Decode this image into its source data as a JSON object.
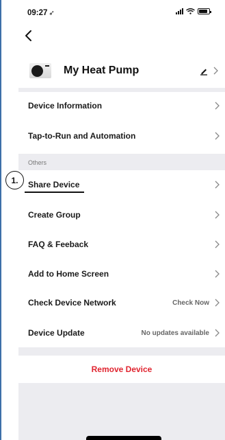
{
  "status_bar": {
    "time": "09:27",
    "location_arrow": "location-arrow-icon"
  },
  "device": {
    "name": "My Heat Pump"
  },
  "menu_top": [
    {
      "label": "Device Information"
    },
    {
      "label": "Tap-to-Run and Automation"
    }
  ],
  "section_others": "Others",
  "menu_others": [
    {
      "label": "Share Device"
    },
    {
      "label": "Create Group"
    },
    {
      "label": "FAQ & Feeback"
    },
    {
      "label": "Add to Home Screen"
    },
    {
      "label": "Check Device Network",
      "value": "Check Now"
    },
    {
      "label": "Device Update",
      "value": "No updates available"
    }
  ],
  "remove_label": "Remove Device",
  "annotation": {
    "step": "1."
  },
  "colors": {
    "danger": "#e0242f",
    "section_bg": "#ececf0",
    "frame": "#3d6fa8"
  }
}
